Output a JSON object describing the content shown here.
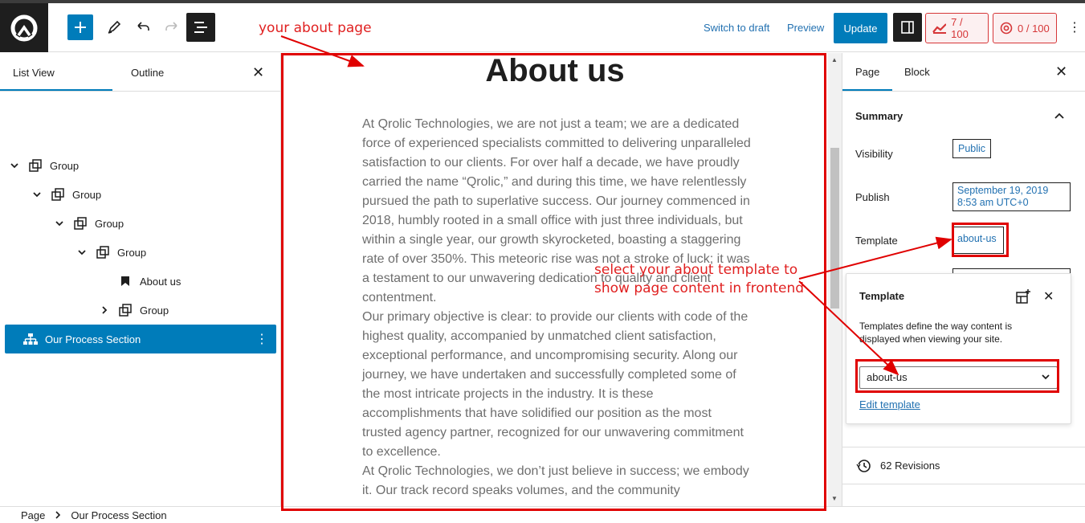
{
  "header": {
    "switch_to_draft": "Switch to draft",
    "preview": "Preview",
    "update": "Update",
    "seo_score": "7 / 100",
    "readability_score": "0 / 100"
  },
  "left_panel": {
    "tabs": [
      "List View",
      "Outline"
    ],
    "tree": [
      {
        "label": "Group",
        "level": 0,
        "expanded": true,
        "icon": "group-icon"
      },
      {
        "label": "Group",
        "level": 1,
        "expanded": true,
        "icon": "group-icon"
      },
      {
        "label": "Group",
        "level": 2,
        "expanded": true,
        "icon": "group-icon"
      },
      {
        "label": "Group",
        "level": 3,
        "expanded": true,
        "icon": "group-icon"
      },
      {
        "label": "About us",
        "level": 4,
        "expanded": null,
        "icon": "bookmark-icon"
      },
      {
        "label": "Group",
        "level": 4,
        "expanded": false,
        "icon": "group-icon"
      },
      {
        "label": "Our Process Section",
        "level": 0,
        "expanded": null,
        "icon": "sitemap-icon",
        "selected": true
      }
    ]
  },
  "canvas": {
    "title": "About us",
    "paragraphs": [
      "At Qrolic Technologies, we are not just a team; we are a dedicated force of experienced specialists committed to delivering unparalleled satisfaction to our clients. For over half a decade, we have proudly carried the name “Qrolic,” and during this time, we have relentlessly pursued the path to superlative success. Our journey commenced in 2018, humbly rooted in a small office with just three individuals, but within a single year, our growth skyrocketed, boasting a staggering rate of over 350%. This meteoric rise was not a stroke of luck; it was a testament to our unwavering dedication to quality and client contentment.",
      "Our primary objective is clear: to provide our clients with code of the highest quality, accompanied by unmatched client satisfaction, exceptional performance, and uncompromising security. Along our journey, we have undertaken and successfully completed some of the most intricate projects in the industry. It is these accomplishments that have solidified our position as the most trusted agency partner, recognized for our unwavering commitment to excellence.",
      "At Qrolic Technologies, we don’t just believe in success; we embody it. Our track record speaks volumes, and the community"
    ]
  },
  "right_panel": {
    "tabs": [
      "Page",
      "Block"
    ],
    "summary_title": "Summary",
    "visibility_label": "Visibility",
    "visibility_value": "Public",
    "publish_label": "Publish",
    "publish_value_line1": "September 19, 2019",
    "publish_value_line2": "8:53 am UTC+0",
    "template_label": "Template",
    "template_value": "about-us",
    "popover": {
      "title": "Template",
      "description": "Templates define the way content is displayed when viewing your site.",
      "select_value": "about-us",
      "edit_link": "Edit template"
    },
    "revisions": "62 Revisions"
  },
  "footer": {
    "breadcrumb": [
      "Page",
      "Our Process Section"
    ]
  },
  "annotations": {
    "top": "your about page",
    "side_line1": "select your about template to",
    "side_line2": "show page content in frontend"
  },
  "colors": {
    "accent": "#007cba",
    "annotation": "#e00000",
    "seo_score": "#d63638"
  }
}
